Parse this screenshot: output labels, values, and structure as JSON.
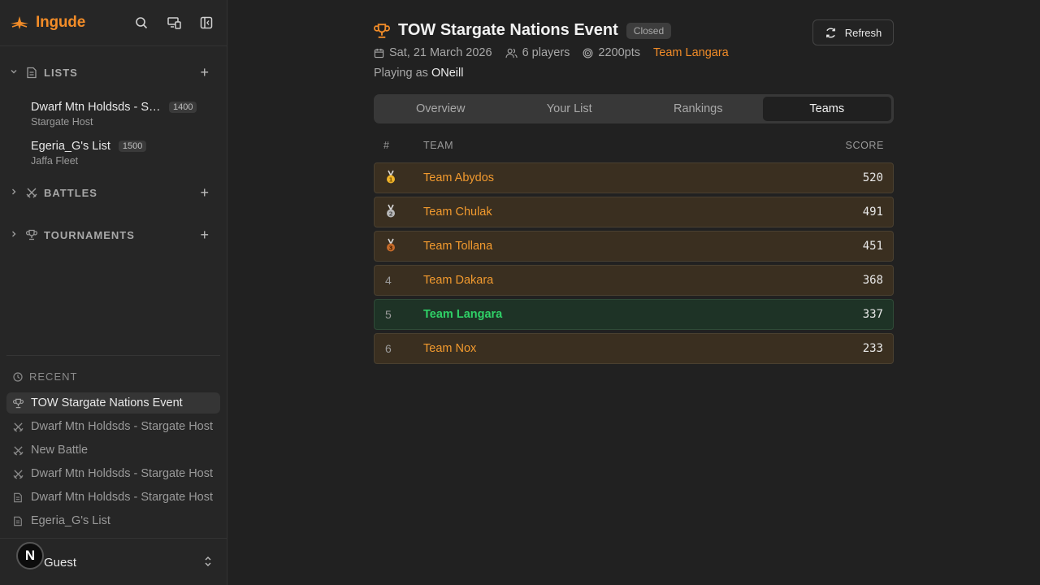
{
  "app": {
    "name": "Ingude",
    "brand_color": "#f28c28"
  },
  "sidebar": {
    "sections": [
      {
        "label": "LISTS",
        "expanded": true,
        "icon": "file-icon"
      },
      {
        "label": "BATTLES",
        "expanded": false,
        "icon": "crossed-swords-icon"
      },
      {
        "label": "TOURNAMENTS",
        "expanded": false,
        "icon": "trophy-icon"
      }
    ],
    "lists": [
      {
        "title": "Dwarf Mtn Holdsds - Stargate Host",
        "points": "1400",
        "subtitle": "Stargate Host"
      },
      {
        "title": "Egeria_G's List",
        "points": "1500",
        "subtitle": "Jaffa Fleet"
      }
    ],
    "recent_label": "RECENT",
    "recent": [
      {
        "title": "TOW Stargate Nations Event",
        "icon": "trophy-icon",
        "active": true
      },
      {
        "title": "Dwarf Mtn Holdsds - Stargate Host",
        "icon": "crossed-swords-icon"
      },
      {
        "title": "New Battle",
        "icon": "crossed-swords-icon"
      },
      {
        "title": "Dwarf Mtn Holdsds - Stargate Host",
        "icon": "crossed-swords-icon"
      },
      {
        "title": "Dwarf Mtn Holdsds - Stargate Host",
        "icon": "file-icon"
      },
      {
        "title": "Egeria_G's List",
        "icon": "file-icon"
      }
    ],
    "user": {
      "avatar": "N",
      "name": "Guest"
    }
  },
  "event": {
    "title": "TOW Stargate Nations Event",
    "status": "Closed",
    "date": "Sat, 21 March 2026",
    "players": "6 players",
    "points": "2200pts",
    "team": "Team Langara",
    "playing_as_label": "Playing as",
    "playing_as": "ONeill",
    "refresh_label": "Refresh"
  },
  "tabs": [
    {
      "label": "Overview",
      "active": false
    },
    {
      "label": "Your List",
      "active": false
    },
    {
      "label": "Rankings",
      "active": false
    },
    {
      "label": "Teams",
      "active": true
    }
  ],
  "table": {
    "headers": [
      "#",
      "TEAM",
      "SCORE"
    ],
    "rows": [
      {
        "rank": "1",
        "medal": "gold",
        "team": "Team Abydos",
        "score": "520"
      },
      {
        "rank": "2",
        "medal": "silver",
        "team": "Team Chulak",
        "score": "491"
      },
      {
        "rank": "3",
        "medal": "bronze",
        "team": "Team Tollana",
        "score": "451"
      },
      {
        "rank": "4",
        "team": "Team Dakara",
        "score": "368"
      },
      {
        "rank": "5",
        "team": "Team Langara",
        "score": "337",
        "mine": true
      },
      {
        "rank": "6",
        "team": "Team Nox",
        "score": "233"
      }
    ]
  }
}
